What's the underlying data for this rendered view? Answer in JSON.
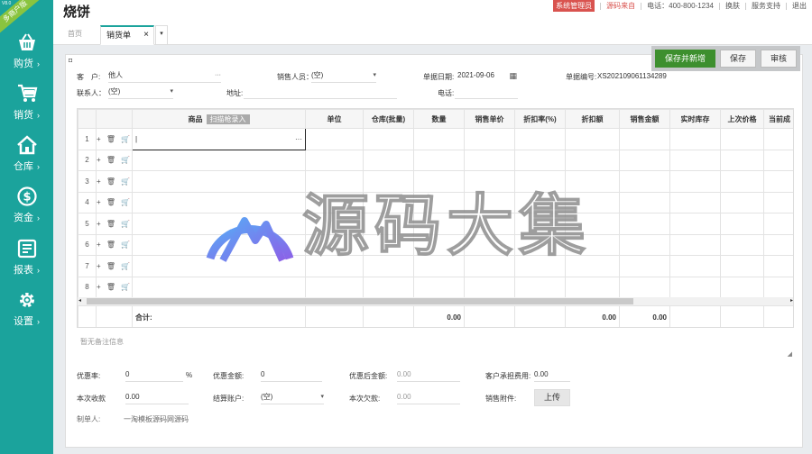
{
  "brand": {
    "ribbon": "多商户版",
    "ribbon_tag": "V8.0"
  },
  "nav": [
    {
      "label": "购货",
      "icon": "basket-icon"
    },
    {
      "label": "销货",
      "icon": "cart-icon"
    },
    {
      "label": "仓库",
      "icon": "house-icon"
    },
    {
      "label": "资金",
      "icon": "dollar-icon"
    },
    {
      "label": "报表",
      "icon": "report-icon"
    },
    {
      "label": "设置",
      "icon": "gear-icon"
    }
  ],
  "nav_arrow": "›",
  "header": {
    "title": "烧饼",
    "admin_badge": "系统管理员",
    "source_link": "源码来自",
    "phone": "电话：400-800-1234",
    "switch_skin": "换肤",
    "support": "服务支持",
    "logout": "退出"
  },
  "tabs": {
    "home": "首页",
    "active": "销货单",
    "close": "×",
    "more": "▾"
  },
  "toolbar": {
    "save_new": "保存并新增",
    "save": "保存",
    "audit": "审核"
  },
  "form": {
    "customer_label": "客　户:",
    "customer_value": "他人",
    "customer_more": "···",
    "salesperson_label": "销售人员：",
    "salesperson_value": "(空)",
    "doc_date_label": "单据日期:",
    "doc_date_value": "2021-09-06",
    "doc_no_label": "单据编号:",
    "doc_no_value": "XS202109061134289",
    "contact_label": "联系人：",
    "contact_value": "(空)",
    "address_label": "地址:",
    "address_value": "",
    "tel_label": "电话:",
    "tel_value": ""
  },
  "grid": {
    "columns": [
      "",
      "",
      "商品",
      "单位",
      "仓库(批量)",
      "数量",
      "销售单价",
      "折扣率(%)",
      "折扣额",
      "销售金额",
      "实时库存",
      "上次价格",
      "当前成"
    ],
    "scan_tag": "扫描枪录入",
    "rows": [
      "1",
      "2",
      "3",
      "4",
      "5",
      "6",
      "7",
      "8"
    ],
    "row_actions": "+ 🗑 🛒",
    "active_cell_more": "···",
    "scroll_left": "◂",
    "scroll_right": "▸",
    "totals": {
      "label": "合计:",
      "quantity": "0.00",
      "discount": "0.00",
      "amount": "0.00"
    }
  },
  "remark_placeholder": "暂无备注信息",
  "footer": {
    "discount_rate_label": "优惠率:",
    "discount_rate_value": "0",
    "percent": "%",
    "discount_amount_label": "优惠金额:",
    "discount_amount_value": "0",
    "after_discount_label": "优惠后金额:",
    "after_discount_value": "0.00",
    "customer_fee_label": "客户承担费用:",
    "customer_fee_value": "0.00",
    "received_label": "本次收款",
    "received_value": "0.00",
    "account_label": "结算账户:",
    "account_value": "(空)",
    "owed_label": "本次欠款:",
    "owed_value": "0.00",
    "attachment_label": "销售附件:",
    "upload_button": "上传",
    "maker_label": "制单人:",
    "maker_value": "一淘模板源码网源码"
  },
  "watermark": {
    "text": "源码大集"
  },
  "colors": {
    "sidebar": "#1ba39c",
    "primary_button": "#3d8f2e",
    "badge_red": "#d9534f",
    "ribbon": "#8ac43f"
  }
}
